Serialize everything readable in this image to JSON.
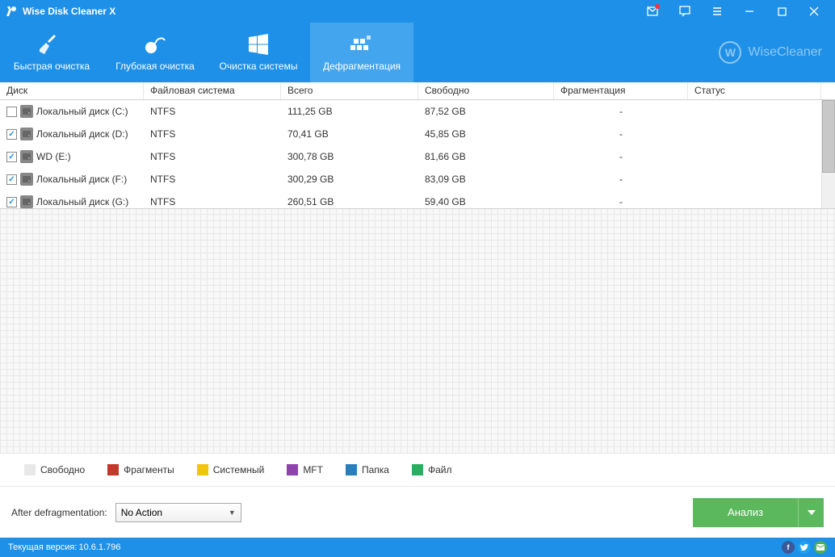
{
  "titlebar": {
    "title": "Wise Disk Cleaner X"
  },
  "tabs": [
    {
      "id": "quick",
      "label": "Быстрая очистка"
    },
    {
      "id": "deep",
      "label": "Глубокая очистка"
    },
    {
      "id": "system",
      "label": "Очистка системы"
    },
    {
      "id": "defrag",
      "label": "Дефрагментация"
    }
  ],
  "brand": {
    "letter": "W",
    "name": "WiseCleaner"
  },
  "columns": {
    "disk": "Диск",
    "fs": "Файловая система",
    "total": "Всего",
    "free": "Свободно",
    "frag": "Фрагментация",
    "status": "Статус"
  },
  "disks": [
    {
      "checked": false,
      "name": "Локальный диск (C:)",
      "fs": "NTFS",
      "total": "111,25 GB",
      "free": "87,52 GB",
      "frag": "-",
      "status": ""
    },
    {
      "checked": true,
      "name": "Локальный диск (D:)",
      "fs": "NTFS",
      "total": "70,41 GB",
      "free": "45,85 GB",
      "frag": "-",
      "status": ""
    },
    {
      "checked": true,
      "name": "WD (E:)",
      "fs": "NTFS",
      "total": "300,78 GB",
      "free": "81,66 GB",
      "frag": "-",
      "status": ""
    },
    {
      "checked": true,
      "name": "Локальный диск (F:)",
      "fs": "NTFS",
      "total": "300,29 GB",
      "free": "83,09 GB",
      "frag": "-",
      "status": ""
    },
    {
      "checked": true,
      "name": "Локальный диск (G:)",
      "fs": "NTFS",
      "total": "260,51 GB",
      "free": "59,40 GB",
      "frag": "-",
      "status": ""
    }
  ],
  "legend": [
    {
      "label": "Свободно",
      "color": "#e8e8e8"
    },
    {
      "label": "Фрагменты",
      "color": "#c0392b"
    },
    {
      "label": "Системный",
      "color": "#f1c40f"
    },
    {
      "label": "MFT",
      "color": "#8e44ad"
    },
    {
      "label": "Папка",
      "color": "#2980b9"
    },
    {
      "label": "Файл",
      "color": "#27ae60"
    }
  ],
  "bottom": {
    "after_label": "After defragmentation:",
    "after_value": "No Action",
    "analyze": "Анализ"
  },
  "status": {
    "version_label": "Текущая версия:",
    "version": "10.6.1.796"
  }
}
